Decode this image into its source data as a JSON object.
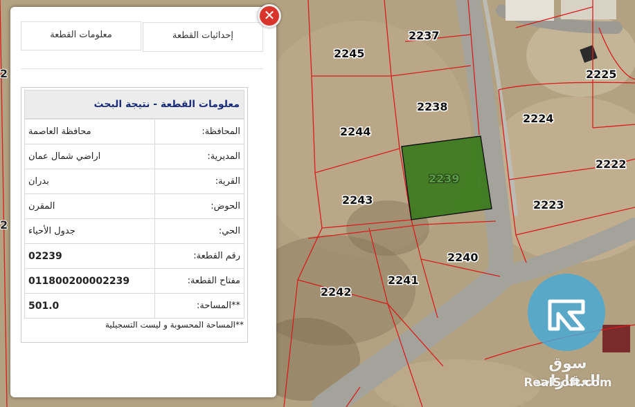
{
  "map": {
    "selected_plot": "2239",
    "plot_labels": [
      "2237",
      "2245",
      "2225",
      "2238",
      "2224",
      "2244",
      "2239",
      "2222",
      "2243",
      "2223",
      "2240",
      "2241",
      "2242"
    ],
    "edge_labels": [
      "2",
      "2"
    ],
    "colors": {
      "parcel_line": "#d81c1c",
      "selected_fill": "#3a7a1c",
      "road": "#9c9c94"
    }
  },
  "panel": {
    "close_icon": "✕",
    "tabs": {
      "coords": "إحداثيات القطعة",
      "info": "معلومات القطعة"
    },
    "title": "معلومات القطعة - نتيجة البحث",
    "rows": [
      {
        "label": "المحافظة:",
        "value": "محافظة العاصمة"
      },
      {
        "label": "المديرية:",
        "value": "اراضي شمال عمان"
      },
      {
        "label": "القرية:",
        "value": "بدران"
      },
      {
        "label": "الحوض:",
        "value": "المقرن"
      },
      {
        "label": "الحي:",
        "value": "جدول الأحياء"
      },
      {
        "label": "رقم القطعة:",
        "value": "02239"
      },
      {
        "label": "مفتاح القطعة:",
        "value": "011800200002239"
      },
      {
        "label": "**المساحة:",
        "value": "501.0"
      }
    ],
    "note": "**المساحة المحسوبة و ليست التسجيلية"
  },
  "watermark": {
    "arabic": "سوق العقارات",
    "english": "RealSoft.com"
  }
}
